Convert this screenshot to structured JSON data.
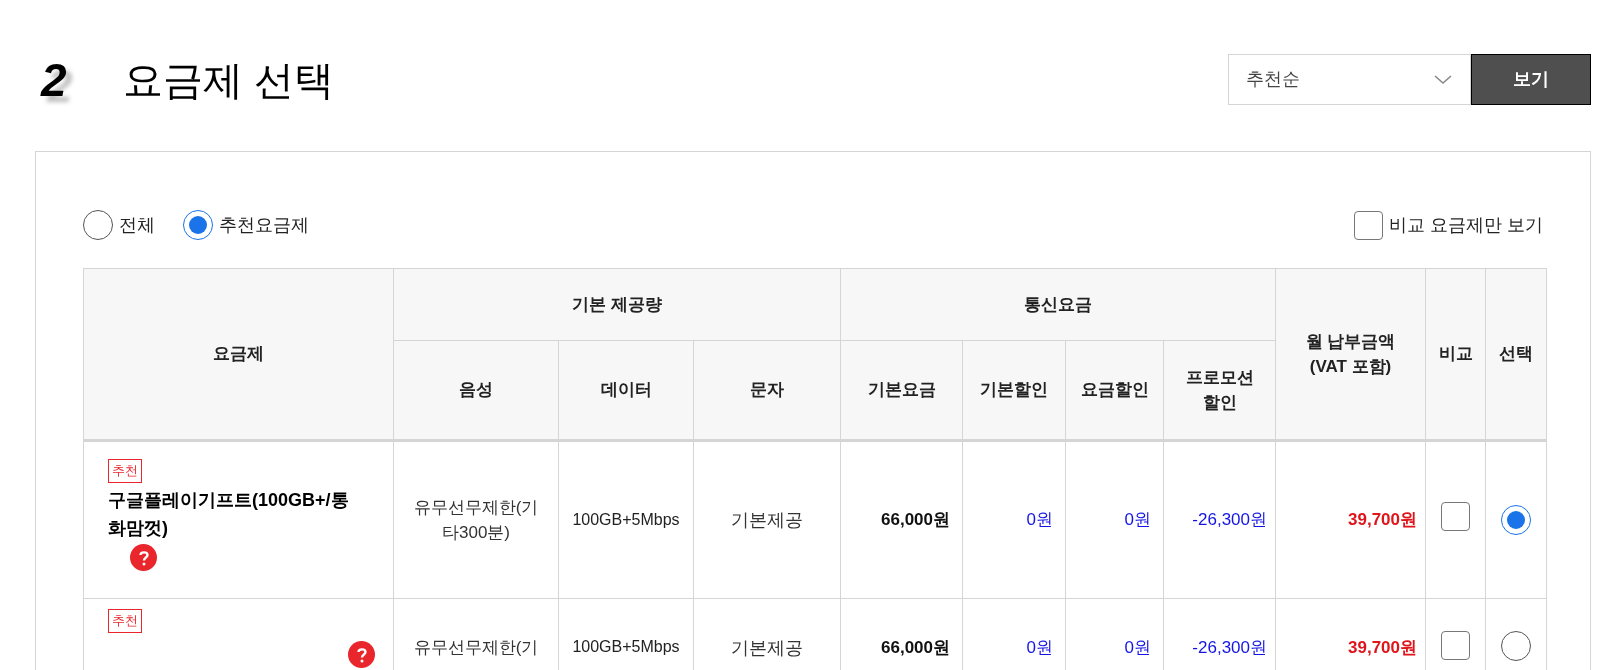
{
  "section": {
    "number": "2",
    "title": "요금제 선택"
  },
  "sort": {
    "value": "추천순",
    "button": "보기"
  },
  "filters": [
    {
      "label": "전체",
      "selected": false
    },
    {
      "label": "추천요금제",
      "selected": true
    }
  ],
  "compare_only": {
    "label": "비교 요금제만 보기",
    "checked": false
  },
  "table": {
    "columns": [
      {
        "label": "요금제"
      },
      {
        "label": "기본 제공량",
        "children": [
          {
            "label": "음성"
          },
          {
            "label": "데이터"
          },
          {
            "label": "문자"
          }
        ]
      },
      {
        "label": "통신요금",
        "children": [
          {
            "label": "기본요금"
          },
          {
            "label": "기본할인"
          },
          {
            "label": "요금할인"
          },
          {
            "label": "프로모션 할인"
          }
        ]
      },
      {
        "label": "월 납부금액 (VAT 포함)"
      },
      {
        "label": "비교"
      },
      {
        "label": "선택"
      }
    ],
    "rows": [
      {
        "badge": "추천",
        "name": "구글플레이기프트(100GB+/통화맘껏)",
        "voice": "유무선무제한(기타300분)",
        "data": "100GB+5Mbps",
        "sms": "기본제공",
        "base_fee": "66,000원",
        "base_discount": "0원",
        "fee_discount": "0원",
        "promo_discount": "-26,300원",
        "monthly": "39,700원",
        "compare": false,
        "selected": true
      },
      {
        "badge": "추천",
        "voice": "유무선무제한(기",
        "data": "100GB+5Mbps",
        "sms": "기본제공",
        "base_fee": "66,000원",
        "base_discount": "0원",
        "fee_discount": "0원",
        "promo_discount": "-26,300원",
        "monthly": "39,700원",
        "compare": false,
        "selected": false
      }
    ]
  }
}
